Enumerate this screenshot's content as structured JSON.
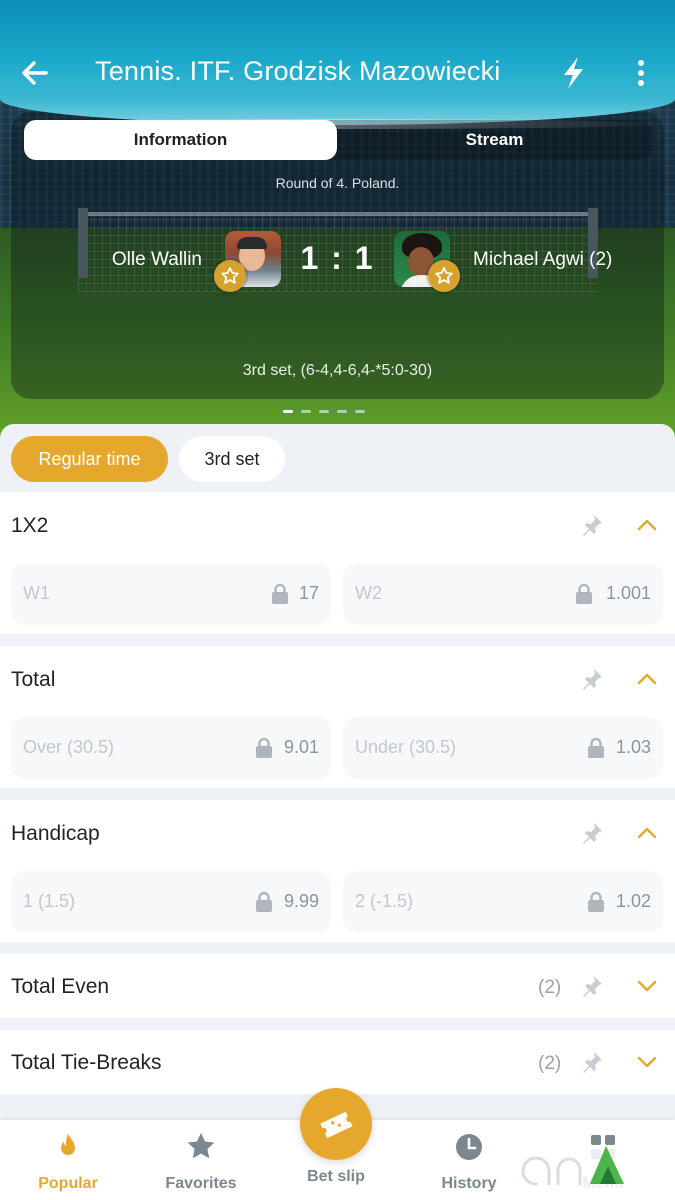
{
  "header": {
    "title": "Tennis. ITF. Grodzisk Mazowiecki"
  },
  "tabs": {
    "information": "Information",
    "stream": "Stream"
  },
  "match": {
    "round": "Round of 4. Poland.",
    "player1": "Olle Wallin",
    "player2": "Michael Agwi (2)",
    "score": "1 : 1",
    "set_info": "3rd set, (6-4,4-6,4-*5:0-30)"
  },
  "periods": {
    "regular": "Regular time",
    "third": "3rd set"
  },
  "markets": [
    {
      "title": "1X2",
      "odds": [
        {
          "label": "W1",
          "value": "17"
        },
        {
          "label": "W2",
          "value": "1.001"
        }
      ]
    },
    {
      "title": "Total",
      "odds": [
        {
          "label": "Over (30.5)",
          "value": "9.01"
        },
        {
          "label": "Under (30.5)",
          "value": "1.03"
        }
      ]
    },
    {
      "title": "Handicap",
      "odds": [
        {
          "label": "1 (1.5)",
          "value": "9.99"
        },
        {
          "label": "2 (-1.5)",
          "value": "1.02"
        }
      ]
    },
    {
      "title": "Total Even",
      "count": "(2)"
    },
    {
      "title": "Total Tie-Breaks",
      "count": "(2)"
    }
  ],
  "nav": {
    "popular": "Popular",
    "favorites": "Favorites",
    "betslip": "Bet slip",
    "history": "History",
    "menu": "Menu"
  },
  "colors": {
    "accent": "#e6a82c",
    "header": "#1aa7c9"
  }
}
